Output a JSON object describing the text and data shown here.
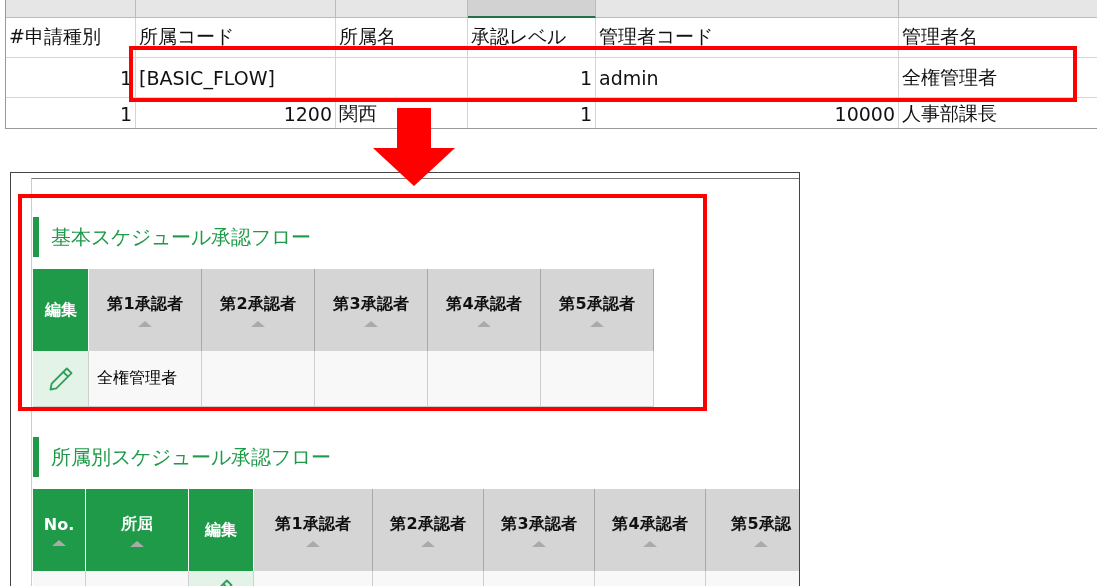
{
  "spreadsheet": {
    "header_row": [
      "#申請種別",
      "所属コード",
      "所属名",
      "承認レベル",
      "管理者コード",
      "管理者名"
    ],
    "rows": [
      [
        {
          "text": "1",
          "kind": "number"
        },
        {
          "text": "[BASIC_FLOW]",
          "kind": "text"
        },
        {},
        {
          "text": "1",
          "kind": "number"
        },
        {
          "text": "admin",
          "kind": "text"
        },
        {
          "text": "全権管理者",
          "kind": "text"
        }
      ],
      [
        {
          "text": "1",
          "kind": "number"
        },
        {
          "text": "1200",
          "kind": "number"
        },
        {
          "text": "関西",
          "kind": "text"
        },
        {
          "text": "1",
          "kind": "number"
        },
        {
          "text": "10000",
          "kind": "number"
        },
        {
          "text": "人事部課長",
          "kind": "text"
        }
      ]
    ]
  },
  "sections": [
    {
      "title": "基本スケジュール承認フロー",
      "columns": [
        {
          "label": "編集",
          "kind": "edit",
          "sortable": false
        },
        {
          "label": "第1承認者",
          "kind": "approver",
          "sortable": true
        },
        {
          "label": "第2承認者",
          "kind": "approver",
          "sortable": true
        },
        {
          "label": "第3承認者",
          "kind": "approver",
          "sortable": true
        },
        {
          "label": "第4承認者",
          "kind": "approver",
          "sortable": true
        },
        {
          "label": "第5承認者",
          "kind": "approver",
          "sortable": true
        }
      ],
      "rows": [
        {
          "cells": [
            "",
            "全権管理者"
          ],
          "cut": false
        }
      ]
    },
    {
      "title": "所属別スケジュール承認フロー",
      "columns": [
        {
          "label": "No.",
          "kind": "key",
          "sortable": true
        },
        {
          "label": "所屈",
          "kind": "key",
          "sortable": true
        },
        {
          "label": "編集",
          "kind": "edit",
          "sortable": false
        },
        {
          "label": "第1承認者",
          "kind": "approver",
          "sortable": true
        },
        {
          "label": "第2承認者",
          "kind": "approver",
          "sortable": true
        },
        {
          "label": "第3承認者",
          "kind": "approver",
          "sortable": true
        },
        {
          "label": "第4承認者",
          "kind": "approver",
          "sortable": true
        },
        {
          "label": "第5承認",
          "kind": "approver",
          "sortable": true
        }
      ],
      "rows": [
        {
          "cut": true
        }
      ]
    }
  ]
}
